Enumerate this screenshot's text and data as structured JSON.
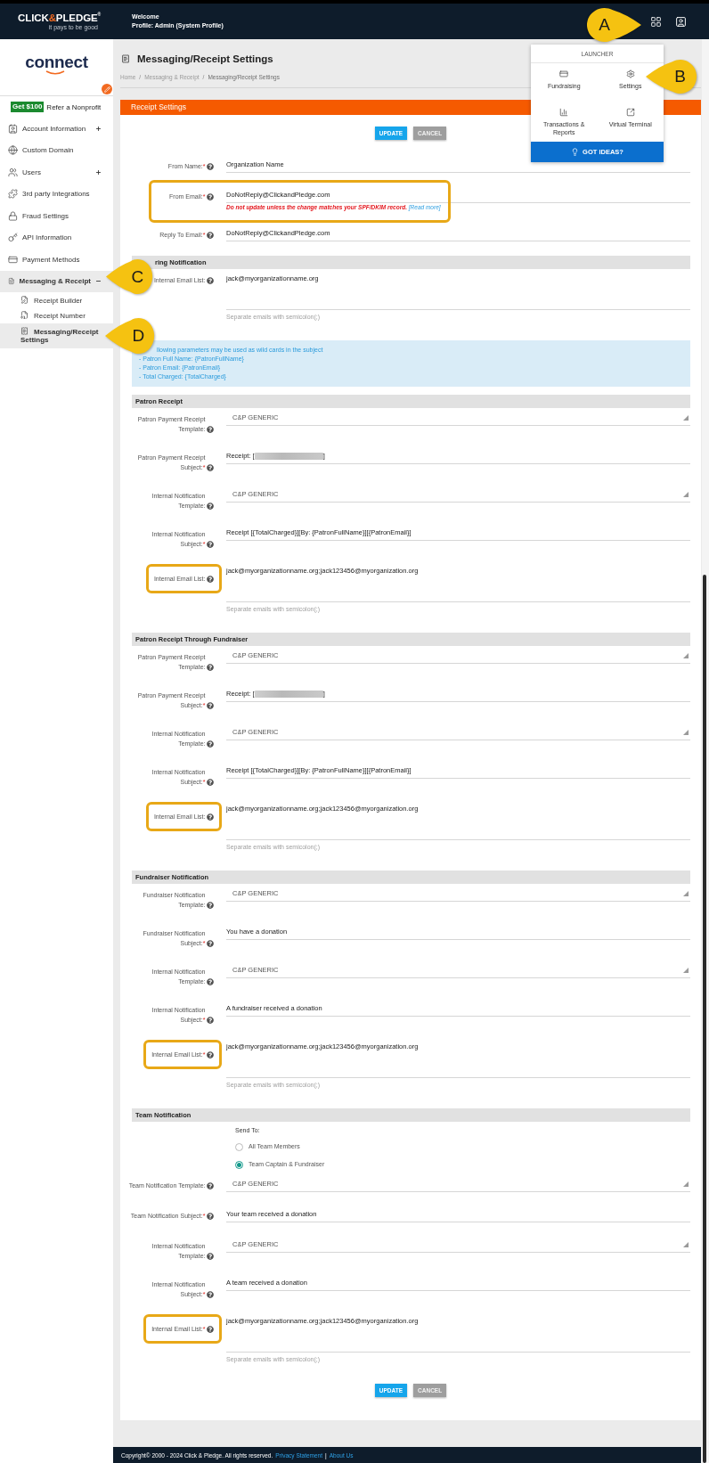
{
  "header": {
    "brand": [
      {
        "text": "CLICK",
        "color": "#ffffff"
      },
      {
        "text": "&",
        "color": "#f26a21"
      },
      {
        "text": "PLEDGE$^{®}$",
        "color": "#ffffff"
      }
    ],
    "tagline": "it pays to be good",
    "welcome": "Welcome",
    "profile": "Profile: Admin (System Profile)"
  },
  "launcher": {
    "title": "LAUNCHER",
    "items": [
      {
        "label": "Fundraising"
      },
      {
        "label": "Settings"
      },
      {
        "label": "Transactions & Reports"
      },
      {
        "label": "Virtual Terminal"
      }
    ],
    "cta": "GOT IDEAS?"
  },
  "callouts": [
    {
      "letter": "A"
    },
    {
      "letter": "B"
    },
    {
      "letter": "C"
    },
    {
      "letter": "D"
    }
  ],
  "sidebar": {
    "logo": "connect",
    "promo": {
      "badge": "Get $100",
      "text": "Refer a Nonprofit"
    },
    "items": [
      {
        "kind": "group",
        "label": "Account Information",
        "expanded": false,
        "selected": false
      },
      {
        "kind": "link",
        "label": "Custom Domain",
        "selected": false
      },
      {
        "kind": "group",
        "label": "Users",
        "expanded": false,
        "selected": false
      },
      {
        "kind": "link",
        "label": "3rd party Integrations",
        "selected": false
      },
      {
        "kind": "link",
        "label": "Fraud Settings",
        "selected": false
      },
      {
        "kind": "link",
        "label": "API Information",
        "selected": false
      },
      {
        "kind": "link",
        "label": "Payment Methods",
        "selected": false
      },
      {
        "kind": "group",
        "label": "Messaging & Receipt",
        "expanded": true,
        "selected": true,
        "children": [
          {
            "label": "Receipt Builder",
            "selected": false
          },
          {
            "label": "Receipt Number",
            "selected": false
          },
          {
            "label": "Messaging/Receipt Settings",
            "selected": true
          }
        ]
      }
    ]
  },
  "page": {
    "title": "Messaging/Receipt Settings",
    "breadcrumb": [
      {
        "kind": "link",
        "text": "Home"
      },
      {
        "kind": "separator",
        "text": "/"
      },
      {
        "kind": "link",
        "text": "Messaging & Receipt"
      },
      {
        "kind": "separator",
        "text": "/"
      },
      {
        "kind": "current",
        "text": "Messaging/Receipt Settings"
      }
    ],
    "panel_title": "Receipt Settings"
  },
  "buttons_top": [
    {
      "kind": "primary",
      "label": "UPDATE"
    },
    {
      "kind": "secondary",
      "label": "CANCEL"
    }
  ],
  "sections": [
    {
      "fields": [
        {
          "kind": "text",
          "label": "From Name:",
          "required_mark": "*",
          "value": "Organization Name"
        },
        {
          "kind": "text",
          "label": "From Email:",
          "required_mark": "*",
          "value": "DoNotReply@ClickandPledge.com",
          "warning": "Do not update unless the change matches your SPF/DKIM record.",
          "warning_link": "[Read more]",
          "row_highlighted": true
        },
        {
          "kind": "text",
          "label": "Reply To Email:",
          "required_mark": "*",
          "value": "DoNotReply@ClickandPledge.com"
        }
      ]
    },
    {
      "title": "ring Notification",
      "fields": [
        {
          "kind": "textarea",
          "label": "Internal Email List:",
          "value": "jack@myorganizationname.org",
          "hint": "Separate emails with semicolon(;)"
        }
      ],
      "notice": [
        "llowing parameters may be used as wild cards in the subject",
        "- Patron Full Name: {PatronFullName}",
        "- Patron Email: {PatronEmail}",
        "- Total Charged: {TotalCharged}"
      ]
    },
    {
      "title": "Patron Receipt",
      "fields": [
        {
          "kind": "select",
          "label": "Patron Payment Receipt Template:",
          "value": "C&P GENERIC"
        },
        {
          "kind": "text",
          "label": "Patron Payment Receipt Subject:",
          "required_mark": "*",
          "value": "Receipt: [",
          "redacted": true,
          "suffix": "]"
        },
        {
          "kind": "select",
          "label": "Internal Notification Template:",
          "value": "C&P GENERIC"
        },
        {
          "kind": "text",
          "label": "Internal Notification Subject:",
          "required_mark": "*",
          "value": "Receipt [{TotalCharged}][By: {PatronFullName}][{PatronEmail}]"
        },
        {
          "kind": "textarea",
          "label": "Internal Email List:",
          "value": "jack@myorganizationname.org;jack123456@myorganization.org",
          "hint": "Separate emails with semicolon(;)",
          "label_highlighted": true
        }
      ]
    },
    {
      "title": "Patron Receipt Through Fundraiser",
      "fields": [
        {
          "kind": "select",
          "label": "Patron Payment Receipt Template:",
          "value": "C&P GENERIC"
        },
        {
          "kind": "text",
          "label": "Patron Payment Receipt Subject:",
          "required_mark": "*",
          "value": "Receipt: [",
          "redacted": true,
          "suffix": "]"
        },
        {
          "kind": "select",
          "label": "Internal Notification Template:",
          "value": "C&P GENERIC"
        },
        {
          "kind": "text",
          "label": "Internal Notification Subject:",
          "required_mark": "*",
          "value": "Receipt [{TotalCharged}][By: {PatronFullName}][{PatronEmail}]"
        },
        {
          "kind": "textarea",
          "label": "Internal Email List:",
          "value": "jack@myorganizationname.org;jack123456@myorganization.org",
          "hint": "Separate emails with semicolon(;)",
          "label_highlighted": true
        }
      ]
    },
    {
      "title": "Fundraiser Notification",
      "fields": [
        {
          "kind": "select",
          "label": "Fundraiser Notification Template:",
          "value": "C&P GENERIC"
        },
        {
          "kind": "text",
          "label": "Fundraiser Notification Subject:",
          "required_mark": "*",
          "value": "You have a donation"
        },
        {
          "kind": "select",
          "label": "Internal Notification Template:",
          "value": "C&P GENERIC"
        },
        {
          "kind": "text",
          "label": "Internal Notification Subject:",
          "required_mark": "*",
          "value": "A fundraiser received a donation"
        },
        {
          "kind": "textarea",
          "label": "Internal Email List:",
          "required_mark": "*",
          "value": "jack@myorganizationname.org;jack123456@myorganization.org",
          "hint": "Separate emails with semicolon(;)",
          "label_highlighted": true
        }
      ]
    },
    {
      "title": "Team Notification",
      "fields": [
        {
          "kind": "radio",
          "label": "Send To:",
          "options": [
            {
              "label": "All Team Members",
              "selected": false
            },
            {
              "label": "Team Captain & Fundraiser",
              "selected": true
            }
          ]
        },
        {
          "kind": "select",
          "label": "Team Notification Template:",
          "value": "C&P GENERIC"
        },
        {
          "kind": "text",
          "label": "Team Notification Subject:",
          "required_mark": "*",
          "value": "Your team received a donation"
        },
        {
          "kind": "select",
          "label": "Internal Notification Template:",
          "value": "C&P GENERIC"
        },
        {
          "kind": "text",
          "label": "Internal Notification Subject:",
          "required_mark": "*",
          "value": "A team received a donation"
        },
        {
          "kind": "textarea",
          "label": "Internal Email List:",
          "required_mark": "*",
          "value": "jack@myorganizationname.org;jack123456@myorganization.org",
          "hint": "Separate emails with semicolon(;)",
          "label_highlighted": true
        }
      ]
    }
  ],
  "buttons_bottom": [
    {
      "kind": "primary",
      "label": "UPDATE"
    },
    {
      "kind": "secondary",
      "label": "CANCEL"
    }
  ],
  "footer": {
    "text": "Copyright© 2000 - 2024 Click & Pledge. All rights reserved.",
    "links": [
      {
        "kind": "link",
        "text": "Privacy Statement"
      },
      {
        "kind": "separator",
        "text": "|"
      },
      {
        "kind": "link",
        "text": "About Us"
      }
    ]
  }
}
